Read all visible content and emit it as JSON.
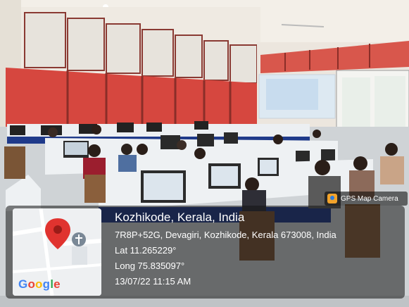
{
  "badge": {
    "label": "GPS Map Camera",
    "icon": "gps-map-camera-icon"
  },
  "location": {
    "title": "Kozhikode, Kerala, India",
    "address": "7R8P+52G, Devagiri, Kozhikode, Kerala 673008, India",
    "lat": "Lat 11.265229°",
    "long": "Long 75.835097°",
    "datetime": "13/07/22 11:15 AM"
  },
  "map": {
    "logo_parts": [
      "G",
      "o",
      "o",
      "g",
      "l",
      "e"
    ],
    "pin_icon": "map-pin-icon",
    "landmark_icon": "church-icon"
  },
  "colors": {
    "wall": "#f0ede6",
    "curtains": "#d6473f",
    "desks": "#eceff2",
    "partitions": "#1f3a8a",
    "projection": "#d9e8f4"
  }
}
